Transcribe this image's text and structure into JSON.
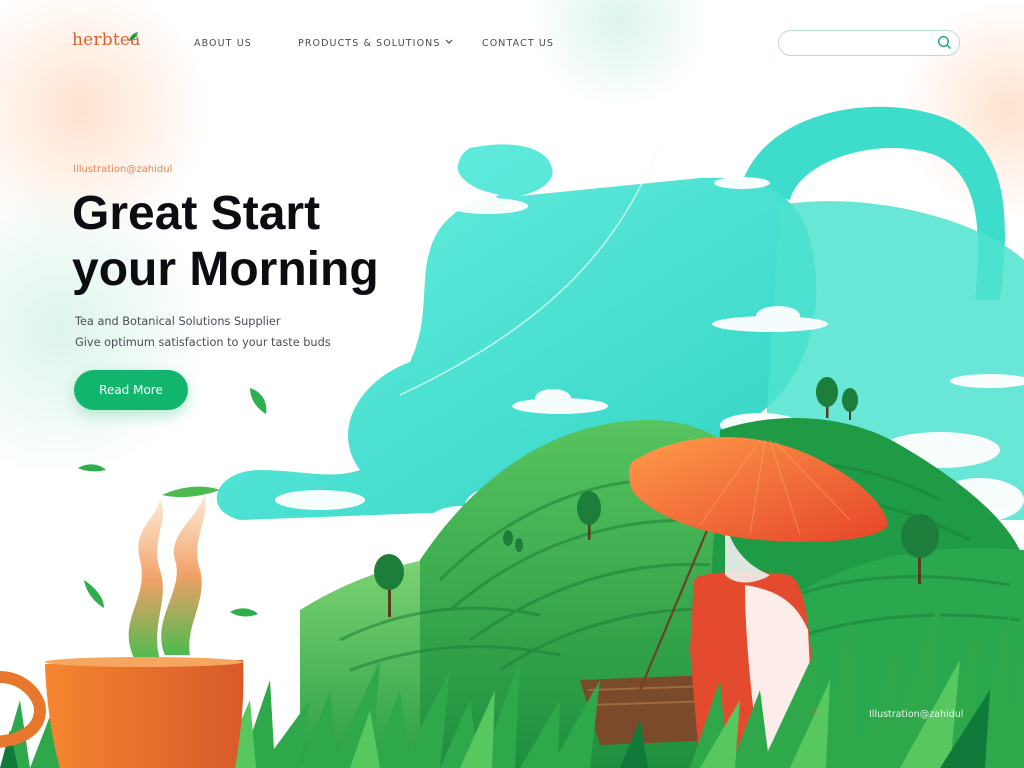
{
  "brand": {
    "name": "herbtea"
  },
  "nav": {
    "items": [
      {
        "label": "ABOUT US"
      },
      {
        "label": "PRODUCTS & SOLUTIONS"
      },
      {
        "label": "CONTACT US"
      }
    ]
  },
  "search": {
    "placeholder": "",
    "value": ""
  },
  "hero": {
    "credit": "Illustration@zahidul",
    "headline_line1": "Great Start",
    "headline_line2": "your Morning",
    "subtitle": "Tea and Botanical Solutions Supplier",
    "tagline": "Give optimum satisfaction to your taste buds",
    "cta_label": "Read More"
  },
  "footer": {
    "watermark": "Illustration@zahidul"
  },
  "colors": {
    "brand": "#e1602e",
    "accent": "#11b56e",
    "sky": "#4fe3cf",
    "hill": "#2fa34a",
    "hat": "#f06a2e"
  },
  "icons": {
    "search": "search-icon",
    "chevron": "chevron-down-icon",
    "leaf": "leaf-icon"
  }
}
